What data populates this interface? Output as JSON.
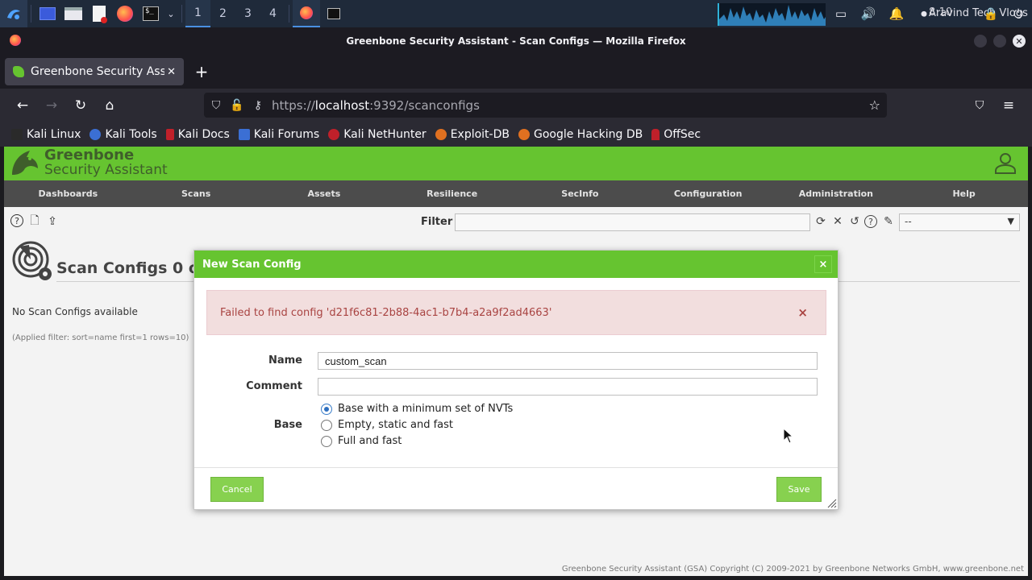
{
  "taskbar": {
    "workspaces": [
      "1",
      "2",
      "3",
      "4"
    ],
    "clock": "8:10",
    "user": "Aravind Tech Vlogs"
  },
  "window": {
    "title": "Greenbone Security Assistant - Scan Configs — Mozilla Firefox"
  },
  "browser": {
    "tab_title": "Greenbone Security Assistant",
    "url_prefix": "https://",
    "url_host": "localhost",
    "url_rest": ":9392/scanconfigs",
    "bookmarks": [
      "Kali Linux",
      "Kali Tools",
      "Kali Docs",
      "Kali Forums",
      "Kali NetHunter",
      "Exploit-DB",
      "Google Hacking DB",
      "OffSec"
    ],
    "bookmark_colors": [
      "#2a2a2a",
      "#3b6fd4",
      "#c0202a",
      "#3b6fd4",
      "#c0202a",
      "#e07020",
      "#e07020",
      "#c0202a"
    ]
  },
  "gsa": {
    "logo_line1": "Greenbone",
    "logo_line2": "Security Assistant",
    "menu": [
      "Dashboards",
      "Scans",
      "Assets",
      "Resilience",
      "SecInfo",
      "Configuration",
      "Administration",
      "Help"
    ],
    "filter_label": "Filter",
    "filter_select_value": "--",
    "section_title": "Scan Configs 0 of 0",
    "empty_message": "No Scan Configs available",
    "applied_filter": "(Applied filter: sort=name first=1 rows=10)",
    "footer": "Greenbone Security Assistant (GSA) Copyright (C) 2009-2021 by Greenbone Networks GmbH, www.greenbone.net"
  },
  "dialog": {
    "title": "New Scan Config",
    "error": "Failed to find config 'd21f6c81-2b88-4ac1-b7b4-a2a9f2ad4663'",
    "name_label": "Name",
    "name_value": "custom_scan",
    "comment_label": "Comment",
    "comment_value": "",
    "base_label": "Base",
    "base_options": [
      "Base with a minimum set of NVTs",
      "Empty, static and fast",
      "Full and fast"
    ],
    "base_selected": "Base with a minimum set of NVTs",
    "cancel_label": "Cancel",
    "save_label": "Save"
  },
  "colors": {
    "gsa_green": "#66c430",
    "menu_bg": "#4c4c4c",
    "button_green": "#87d14f",
    "error_bg": "#f2dede",
    "error_text": "#a94442"
  }
}
